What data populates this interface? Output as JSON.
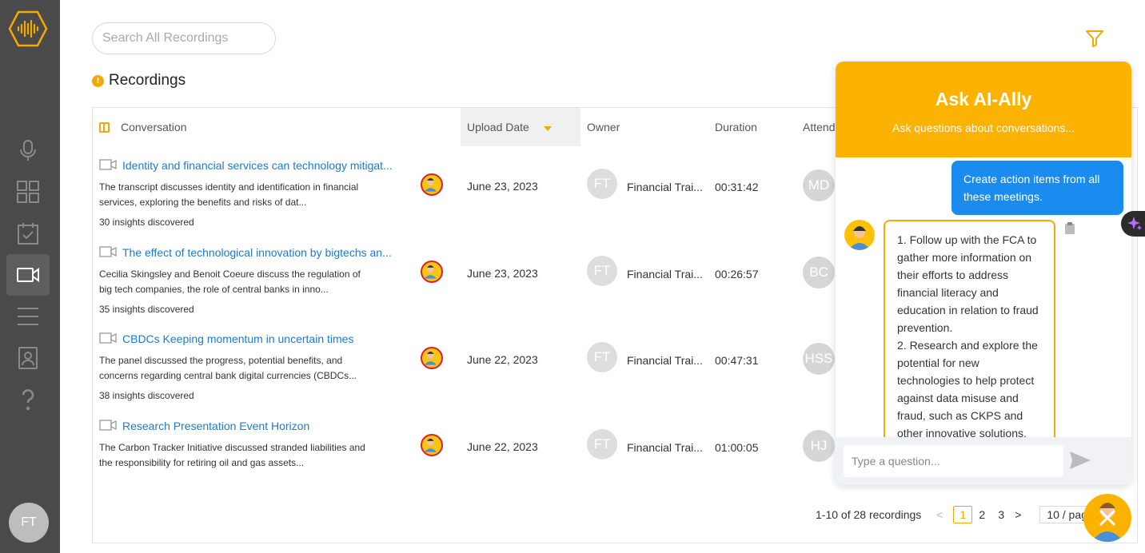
{
  "sidebar": {
    "nav": [
      {
        "name": "microphone-icon"
      },
      {
        "name": "dashboard-grid-icon"
      },
      {
        "name": "calendar-check-icon"
      },
      {
        "name": "video-camera-icon",
        "active": true
      },
      {
        "name": "list-lines-icon"
      },
      {
        "name": "contact-card-icon"
      },
      {
        "name": "help-question-icon"
      }
    ],
    "user_initials": "FT"
  },
  "search": {
    "placeholder": "Search All Recordings"
  },
  "page_title": "Recordings",
  "table": {
    "columns": {
      "conversation": "Conversation",
      "upload_date": "Upload Date",
      "owner": "Owner",
      "duration": "Duration",
      "attendees": "Attend"
    },
    "rows": [
      {
        "title": "Identity and financial services can technology mitigat...",
        "description": "The transcript discusses identity and identification in financial services, exploring the benefits and risks of dat...",
        "insights": "30 insights discovered",
        "date": "June 23, 2023",
        "owner_initials": "FT",
        "owner_name": "Financial Trai...",
        "duration": "00:31:42",
        "attendee": "MD"
      },
      {
        "title": "The effect of technological innovation by bigtechs an...",
        "description": "Cecilia Skingsley and Benoit Coeure discuss the regulation of big tech companies, the role of central banks in inno...",
        "insights": "35 insights discovered",
        "date": "June 23, 2023",
        "owner_initials": "FT",
        "owner_name": "Financial Trai...",
        "duration": "00:26:57",
        "attendee": "BC"
      },
      {
        "title": "CBDCs Keeping momentum in uncertain times",
        "description": "The panel discussed the progress, potential benefits, and concerns regarding central bank digital currencies (CBDCs...",
        "insights": "38 insights discovered",
        "date": "June 22, 2023",
        "owner_initials": "FT",
        "owner_name": "Financial Trai...",
        "duration": "00:47:31",
        "attendee": "HSS"
      },
      {
        "title": "Research Presentation Event Horizon",
        "description": "The Carbon Tracker Initiative discussed stranded liabilities and the responsibility for retiring oil and gas assets...",
        "insights": "",
        "date": "June 22, 2023",
        "owner_initials": "FT",
        "owner_name": "Financial Trai...",
        "duration": "01:00:05",
        "attendee": "HJ"
      }
    ]
  },
  "pagination": {
    "summary": "1-10 of 28 recordings",
    "prev": "<",
    "pages": [
      "1",
      "2",
      "3"
    ],
    "current": "1",
    "next": ">",
    "page_size": "10 / page"
  },
  "chat": {
    "title": "Ask AI-Ally",
    "subtitle": "Ask questions about conversations...",
    "user_message": "Create action items from all these meetings.",
    "bot_message_lines": [
      "1. Follow up with the FCA to gather more information on their efforts to address financial literacy and education in relation to fraud prevention.",
      "2. Research and explore the potential for new technologies to help protect against data misuse and fraud, such as CKPS and other innovative solutions."
    ],
    "input_placeholder": "Type a question..."
  },
  "colors": {
    "accent": "#fbb200",
    "link": "#1a7bd0",
    "sidebar": "#4a4a4a",
    "user_bubble": "#1a8cf0"
  }
}
